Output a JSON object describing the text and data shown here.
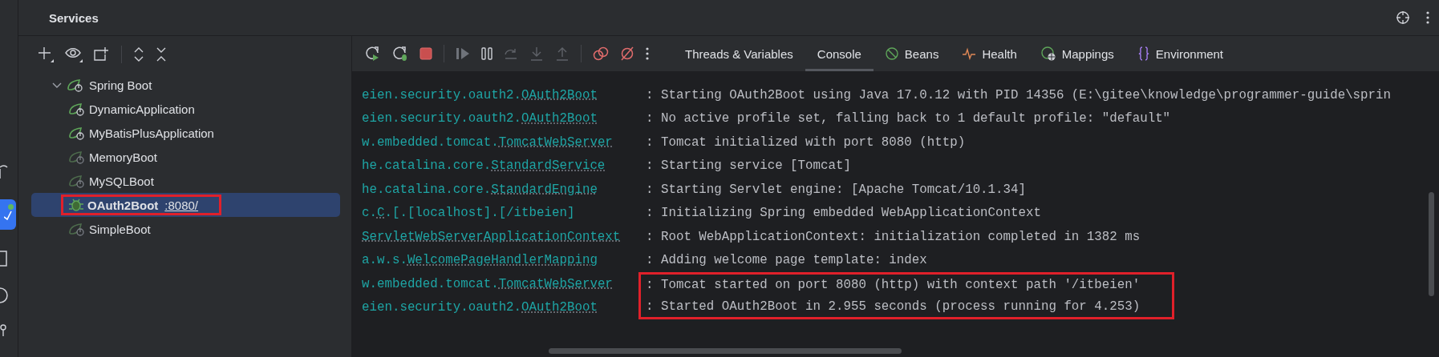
{
  "window": {
    "title": "Services"
  },
  "tree": [
    {
      "label": "Spring Boot",
      "expanded": true,
      "children": [
        {
          "label": "DynamicApplication",
          "kind": "running",
          "selected": false,
          "annotated": false
        },
        {
          "label": "MyBatisPlusApplication",
          "kind": "running",
          "selected": false,
          "annotated": false
        },
        {
          "label": "MemoryBoot",
          "kind": "stopped",
          "selected": false,
          "annotated": false
        },
        {
          "label": "MySQLBoot",
          "kind": "stopped",
          "selected": false,
          "annotated": false
        },
        {
          "label": "OAuth2Boot",
          "link": ":8080/",
          "kind": "debugging",
          "selected": true,
          "annotated": true
        },
        {
          "label": "SimpleBoot",
          "kind": "stopped",
          "selected": false,
          "annotated": false
        }
      ]
    }
  ],
  "tabs": [
    {
      "label": "Threads & Variables",
      "kind": "plain",
      "selected": false
    },
    {
      "label": "Console",
      "kind": "plain",
      "selected": true
    },
    {
      "label": "Beans",
      "kind": "beans",
      "selected": false
    },
    {
      "label": "Health",
      "kind": "health",
      "selected": false
    },
    {
      "label": "Mappings",
      "kind": "mappings",
      "selected": false
    },
    {
      "label": "Environment",
      "kind": "environment",
      "selected": false
    }
  ],
  "console": [
    {
      "logger_prefix": "eien.security.oauth2.",
      "logger_class": "OAuth2Boot",
      "message": ": Starting OAuth2Boot using Java 17.0.12 with PID 14356 (E:\\gitee\\knowledge\\programmer-guide\\sprin",
      "annotated": false
    },
    {
      "logger_prefix": "eien.security.oauth2.",
      "logger_class": "OAuth2Boot",
      "message": ": No active profile set, falling back to 1 default profile: \"default\"",
      "annotated": false
    },
    {
      "logger_prefix": "w.embedded.tomcat.",
      "logger_class": "TomcatWebServer",
      "message": ": Tomcat initialized with port 8080 (http)",
      "annotated": false
    },
    {
      "logger_prefix": "he.catalina.core.",
      "logger_class": "StandardService",
      "message": ": Starting service [Tomcat]",
      "annotated": false
    },
    {
      "logger_prefix": "he.catalina.core.",
      "logger_class": "StandardEngine",
      "message": ": Starting Servlet engine: [Apache Tomcat/10.1.34]",
      "annotated": false
    },
    {
      "logger_prefix": "c.",
      "logger_class": "C",
      "logger_suffix": ".[.[localhost].[/itbeien]",
      "message": ": Initializing Spring embedded WebApplicationContext",
      "annotated": false
    },
    {
      "logger_class": "ServletWebServerApplicationContext",
      "message": ": Root WebApplicationContext: initialization completed in 1382 ms",
      "annotated": false
    },
    {
      "logger_prefix": "a.w.s.",
      "logger_class": "WelcomePageHandlerMapping",
      "message": ": Adding welcome page template: index",
      "annotated": false
    },
    {
      "logger_prefix": "w.embedded.tomcat.",
      "logger_class": "TomcatWebServer",
      "message": ": Tomcat started on port 8080 (http) with context path '/itbeien'",
      "annotated": true
    },
    {
      "logger_prefix": "eien.security.oauth2.",
      "logger_class": "OAuth2Boot",
      "message": ": Started OAuth2Boot in 2.955 seconds (process running for 4.253)",
      "annotated": true
    }
  ]
}
